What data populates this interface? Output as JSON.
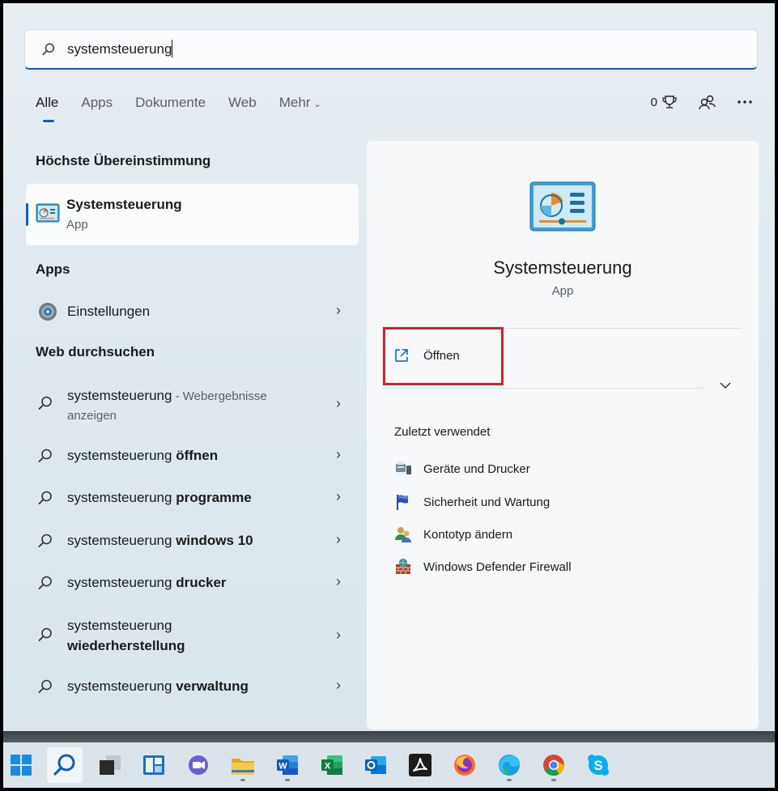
{
  "search": {
    "value": "systemsteuerung",
    "icon": "search-icon"
  },
  "tabs": [
    {
      "label": "Alle",
      "active": true
    },
    {
      "label": "Apps"
    },
    {
      "label": "Dokumente"
    },
    {
      "label": "Web"
    },
    {
      "label": "Mehr"
    }
  ],
  "toolbar": {
    "rewards_count": "0",
    "rewards_icon": "trophy-icon",
    "accounts_icon": "people-icon",
    "more_icon": "ellipsis-icon"
  },
  "best_match": {
    "heading": "Höchste Übereinstimmung",
    "name": "Systemsteuerung",
    "type": "App"
  },
  "apps": {
    "heading": "Apps",
    "items": [
      {
        "label": "Einstellungen",
        "icon": "settings-gear-icon"
      }
    ]
  },
  "web": {
    "heading": "Web durchsuchen",
    "items": [
      {
        "prefix": "systemsteuerung",
        "bold": "",
        "suffix": " - Webergebnisse",
        "line2": "anzeigen"
      },
      {
        "prefix": "systemsteuerung ",
        "bold": "öffnen"
      },
      {
        "prefix": "systemsteuerung ",
        "bold": "programme"
      },
      {
        "prefix": "systemsteuerung ",
        "bold": "windows 10"
      },
      {
        "prefix": "systemsteuerung ",
        "bold": "drucker"
      },
      {
        "prefix": "systemsteuerung",
        "bold": "wiederherstellung"
      },
      {
        "prefix": "systemsteuerung ",
        "bold": "verwaltung"
      }
    ]
  },
  "details": {
    "name": "Systemsteuerung",
    "type": "App",
    "open_label": "Öffnen",
    "recent_heading": "Zuletzt verwendet",
    "recent": [
      {
        "label": "Geräte und Drucker",
        "icon": "devices-printers-icon"
      },
      {
        "label": "Sicherheit und Wartung",
        "icon": "security-flag-icon"
      },
      {
        "label": "Kontotyp ändern",
        "icon": "user-accounts-icon"
      },
      {
        "label": "Windows Defender Firewall",
        "icon": "firewall-icon"
      }
    ]
  },
  "taskbar": [
    {
      "name": "start-icon"
    },
    {
      "name": "search-icon",
      "active": true
    },
    {
      "name": "task-view-icon"
    },
    {
      "name": "widgets-icon"
    },
    {
      "name": "teams-chat-icon"
    },
    {
      "name": "file-explorer-icon",
      "running": true
    },
    {
      "name": "word-icon",
      "running": true
    },
    {
      "name": "excel-icon"
    },
    {
      "name": "outlook-icon"
    },
    {
      "name": "acrobat-icon"
    },
    {
      "name": "firefox-icon"
    },
    {
      "name": "edge-icon",
      "running": true
    },
    {
      "name": "chrome-icon",
      "running": true
    },
    {
      "name": "skype-icon"
    }
  ],
  "colors": {
    "accent": "#005fb8",
    "highlight_border": "#d0212d"
  }
}
